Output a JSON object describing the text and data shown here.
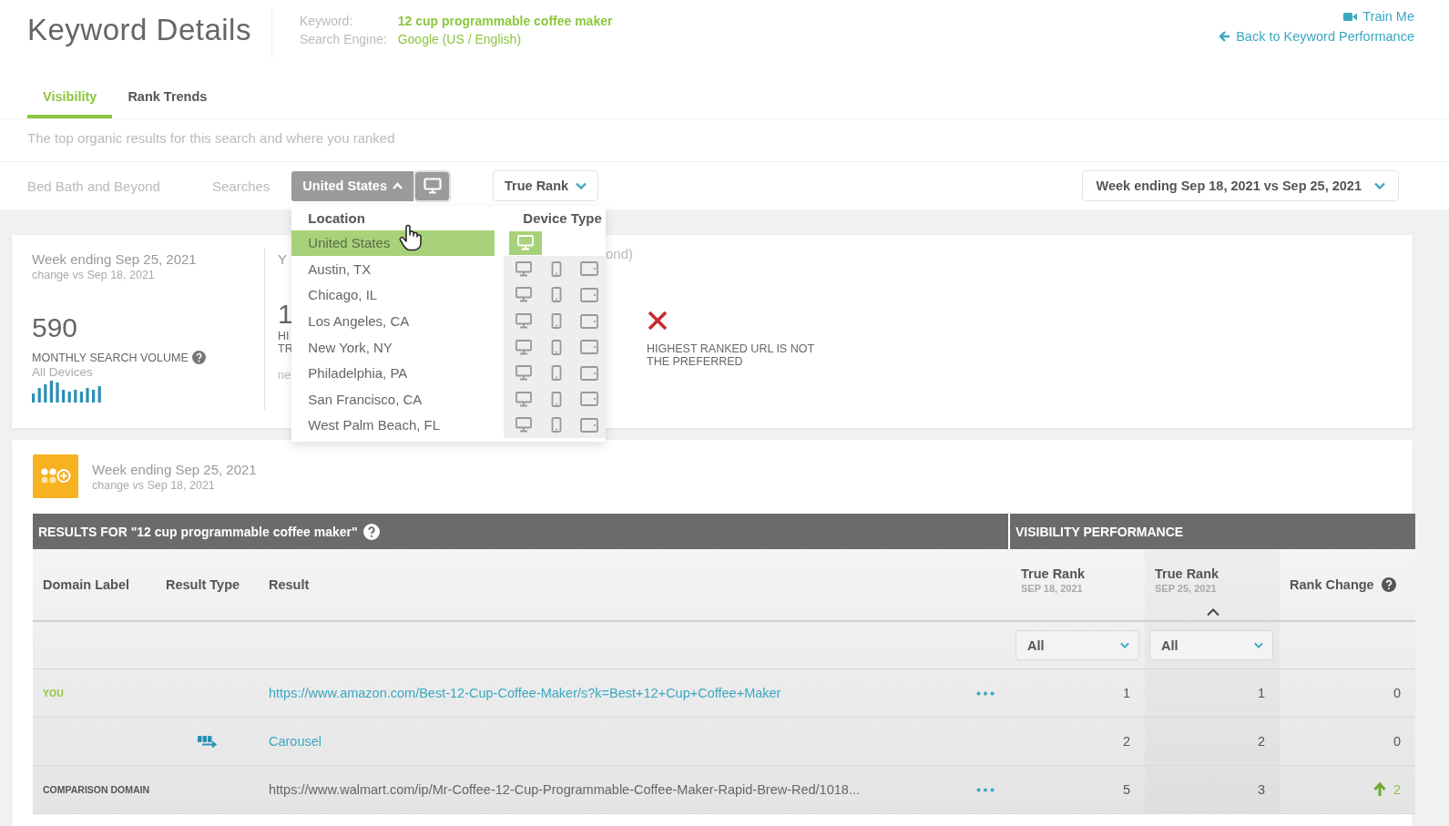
{
  "header": {
    "title": "Keyword Details",
    "keyword_label": "Keyword:",
    "keyword": "12 cup programmable coffee maker",
    "engine_label": "Search Engine:",
    "engine": "Google (US / English)",
    "train_me": "Train Me",
    "back_link": "Back to Keyword Performance"
  },
  "tabs": [
    {
      "label": "Visibility",
      "selected": true
    },
    {
      "label": "Rank Trends",
      "selected": false
    }
  ],
  "subtitle": "The top organic results for this search and where you ranked",
  "filters": {
    "account": "Bed Bath and Beyond",
    "searches_label": "Searches",
    "location": "United States",
    "location_open": true,
    "metric": "True Rank",
    "date_range": "Week ending Sep 18, 2021 vs Sep 25, 2021"
  },
  "location_menu": {
    "location_heading": "Location",
    "device_heading": "Device Type",
    "locations": [
      {
        "name": "United States",
        "selected": true,
        "devices": [
          {
            "kind": "desktop",
            "selected": true
          }
        ]
      },
      {
        "name": "Austin, TX",
        "selected": false,
        "devices": [
          {
            "kind": "desktop",
            "selected": false
          },
          {
            "kind": "mobile",
            "selected": false
          },
          {
            "kind": "tablet",
            "selected": false
          }
        ]
      },
      {
        "name": "Chicago, IL",
        "selected": false,
        "devices": [
          {
            "kind": "desktop",
            "selected": false
          },
          {
            "kind": "mobile",
            "selected": false
          },
          {
            "kind": "tablet",
            "selected": false
          }
        ]
      },
      {
        "name": "Los Angeles, CA",
        "selected": false,
        "devices": [
          {
            "kind": "desktop",
            "selected": false
          },
          {
            "kind": "mobile",
            "selected": false
          },
          {
            "kind": "tablet",
            "selected": false
          }
        ]
      },
      {
        "name": "New York, NY",
        "selected": false,
        "devices": [
          {
            "kind": "desktop",
            "selected": false
          },
          {
            "kind": "mobile",
            "selected": false
          },
          {
            "kind": "tablet",
            "selected": false
          }
        ]
      },
      {
        "name": "Philadelphia, PA",
        "selected": false,
        "devices": [
          {
            "kind": "desktop",
            "selected": false
          },
          {
            "kind": "mobile",
            "selected": false
          },
          {
            "kind": "tablet",
            "selected": false
          }
        ]
      },
      {
        "name": "San Francisco, CA",
        "selected": false,
        "devices": [
          {
            "kind": "desktop",
            "selected": false
          },
          {
            "kind": "mobile",
            "selected": false
          },
          {
            "kind": "tablet",
            "selected": false
          }
        ]
      },
      {
        "name": "West Palm Beach, FL",
        "selected": false,
        "devices": [
          {
            "kind": "desktop",
            "selected": false
          },
          {
            "kind": "mobile",
            "selected": false
          },
          {
            "kind": "tablet",
            "selected": false
          }
        ]
      }
    ]
  },
  "summary": {
    "week": "Week ending Sep 25, 2021",
    "change": "change vs Sep 18, 2021",
    "volume": "590",
    "volume_label": "MONTHLY SEARCH VOLUME",
    "volume_devices": "All Devices",
    "partial_heading": "Y",
    "partial_number": "1",
    "partial_label_1": "HI",
    "partial_label_2": "TR",
    "partial_note": "ne",
    "partial_heading_end": "ond)",
    "issue": "HIGHEST RANKED URL IS NOT THE PREFERRED"
  },
  "results": {
    "week": "Week ending Sep 25, 2021",
    "change": "change vs Sep 18, 2021",
    "heading": "RESULTS FOR \"12 cup programmable coffee maker\"",
    "performance_heading": "VISIBILITY PERFORMANCE",
    "columns": [
      {
        "label": "Domain Label"
      },
      {
        "label": "Result Type"
      },
      {
        "label": "Result"
      },
      {
        "label": "True Rank",
        "date": "SEP 18, 2021",
        "filter": "All",
        "sorted": false
      },
      {
        "label": "True Rank",
        "date": "SEP 25, 2021",
        "filter": "All",
        "sorted": true
      },
      {
        "label": "Rank Change"
      }
    ],
    "rows": [
      {
        "domain_label": "YOU",
        "color": "#8cc63f",
        "carousel": false,
        "result": "https://www.amazon.com/Best-12-Cup-Coffee-Maker/s?k=Best+12+Cup+Coffee+Maker",
        "link": true,
        "menu": true,
        "rank_prev": "1",
        "rank_curr": "1",
        "change": "0",
        "rising": false
      },
      {
        "carousel": true,
        "result": "Carousel",
        "link": true,
        "menu": false,
        "rank_prev": "2",
        "rank_curr": "2",
        "change": "0",
        "rising": false
      },
      {
        "domain_label": "COMPARISON DOMAIN",
        "color": "#555555",
        "carousel": false,
        "result": "https://www.walmart.com/ip/Mr-Coffee-12-Cup-Programmable-Coffee-Maker-Rapid-Brew-Red/1018...",
        "link": false,
        "menu": true,
        "rank_prev": "5",
        "rank_curr": "3",
        "change": "2",
        "rising": true
      }
    ]
  }
}
